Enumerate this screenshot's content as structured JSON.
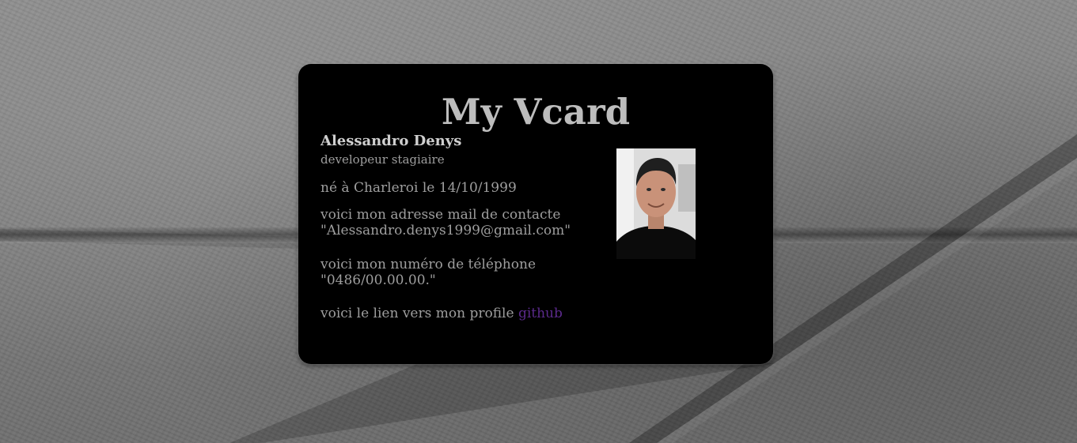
{
  "card": {
    "title": "My Vcard",
    "name": "Alessandro Denys",
    "role": "developeur stagiaire",
    "birth": "né à Charleroi le 14/10/1999",
    "email_intro": "voici mon adresse mail de contacte",
    "email": "\"Alessandro.denys1999@gmail.com\"",
    "phone_intro": "voici mon numéro de téléphone",
    "phone": "\"0486/00.00.00.\"",
    "github_intro": "voici le lien vers mon profile",
    "github_link": "github"
  },
  "colors": {
    "card_background": "#000000",
    "title_text": "#bdbdbd",
    "body_text": "#9e9e9e",
    "link": "#5b2a8c"
  },
  "icons": {
    "profile_photo": "portrait-photo"
  }
}
